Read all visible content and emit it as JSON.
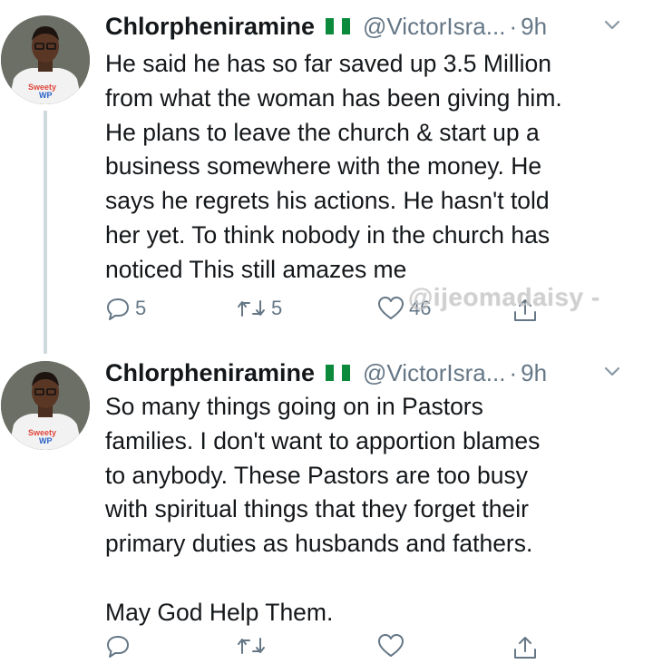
{
  "tweets": [
    {
      "display_name": "Chlorpheniramine",
      "handle": "@VictorIsra...",
      "separator": "·",
      "time": "9h",
      "text": "He said he has so far saved up 3.5 Million\nfrom what the woman has been giving him.\nHe plans to leave the church & start up a\nbusiness somewhere with the money. He\nsays he regrets his actions. He hasn't told\nher yet. To think nobody in the church has\nnoticed This still amazes me",
      "reply_count": "5",
      "retweet_count": "5",
      "like_count": "46"
    },
    {
      "display_name": "Chlorpheniramine",
      "handle": "@VictorIsra...",
      "separator": "·",
      "time": "9h",
      "text": "So many things going on in Pastors\nfamilies. I don't want to apportion blames\nto anybody. These Pastors are too busy\nwith spiritual things that they forget their\nprimary duties as husbands and fathers.\n\nMay God Help Them.",
      "reply_count": "",
      "retweet_count": "",
      "like_count": ""
    }
  ],
  "watermark": "@ijeomadaisy -",
  "avatar_shirt_text": [
    "Sweety",
    "WP"
  ],
  "icons": {
    "flag": "nigeria-flag-icon",
    "more": "chevron-down-icon",
    "reply": "reply-icon",
    "retweet": "retweet-icon",
    "like": "heart-icon",
    "share": "share-icon"
  },
  "colors": {
    "text_primary": "#14171a",
    "text_secondary": "#657786",
    "thread_line": "#cfd9de",
    "flag_green": "#0a8a3a"
  }
}
